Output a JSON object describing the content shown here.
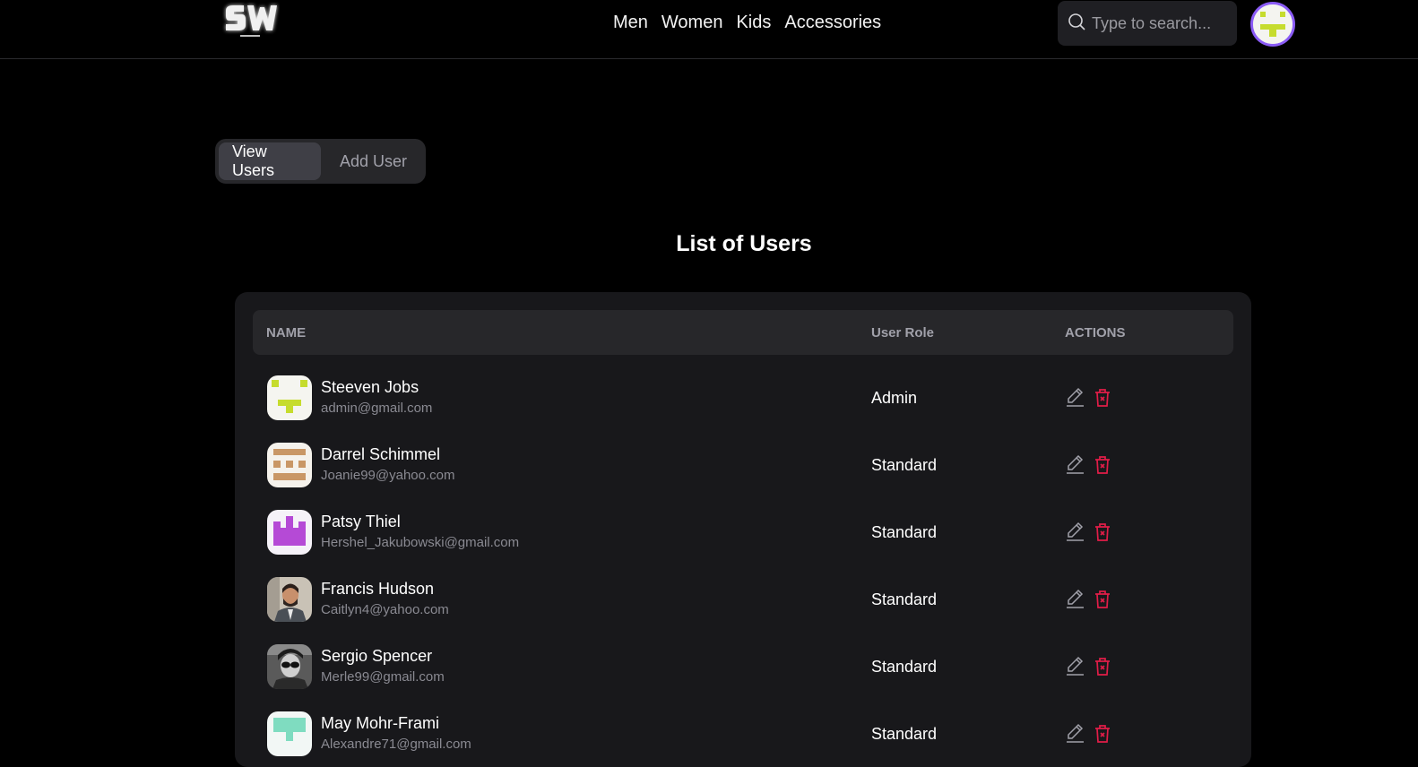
{
  "header": {
    "nav": [
      "Men",
      "Women",
      "Kids",
      "Accessories"
    ],
    "search_placeholder": "Type to search..."
  },
  "tabs": {
    "view": "View Users",
    "add": "Add User"
  },
  "page_title": "List of Users",
  "table": {
    "columns": {
      "name": "NAME",
      "role": "User Role",
      "actions": "ACTIONS"
    },
    "rows": [
      {
        "name": "Steeven Jobs",
        "email": "admin@gmail.com",
        "role": "Admin",
        "avatar": "identicon-lime"
      },
      {
        "name": "Darrel Schimmel",
        "email": "Joanie99@yahoo.com",
        "role": "Standard",
        "avatar": "identicon-tan"
      },
      {
        "name": "Patsy Thiel",
        "email": "Hershel_Jakubowski@gmail.com",
        "role": "Standard",
        "avatar": "identicon-purple"
      },
      {
        "name": "Francis Hudson",
        "email": "Caitlyn4@yahoo.com",
        "role": "Standard",
        "avatar": "photo-man-suit"
      },
      {
        "name": "Sergio Spencer",
        "email": "Merle99@gmail.com",
        "role": "Standard",
        "avatar": "photo-sunglasses"
      },
      {
        "name": "May Mohr-Frami",
        "email": "Alexandre71@gmail.com",
        "role": "Standard",
        "avatar": "identicon-mint"
      }
    ]
  },
  "colors": {
    "accent_purple": "#8b5cf6",
    "delete_red": "#e11d48",
    "card_bg": "#18181b",
    "header_row_bg": "#27272a"
  },
  "icons": [
    "search-icon",
    "edit-pencil-icon",
    "trash-icon"
  ]
}
